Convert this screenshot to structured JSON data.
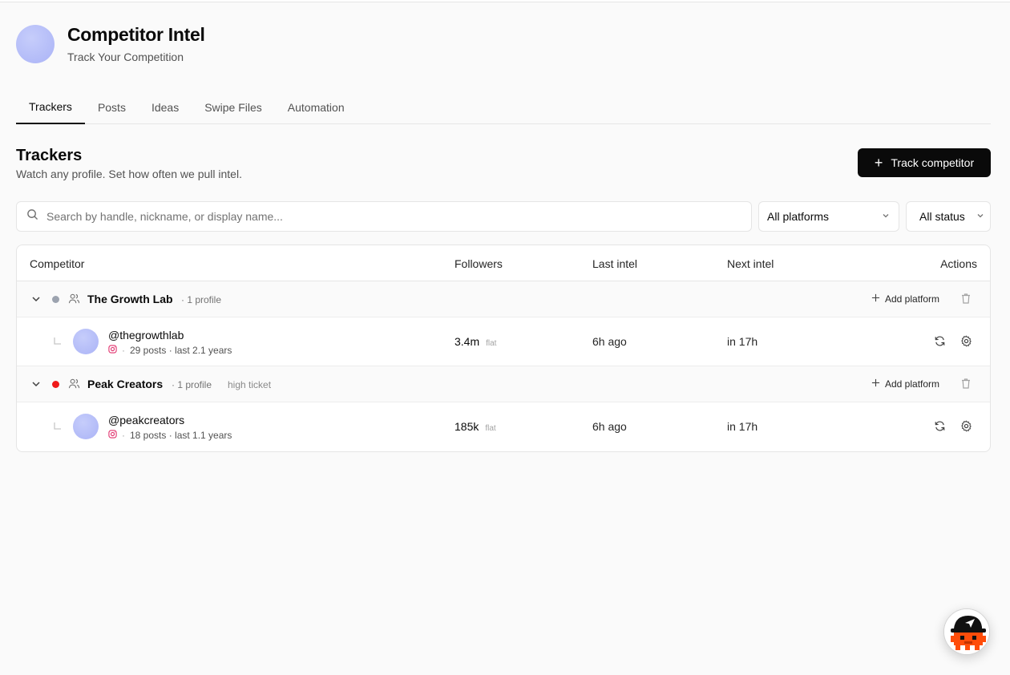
{
  "app": {
    "title": "Competitor Intel",
    "subtitle": "Track Your Competition"
  },
  "tabs": [
    {
      "label": "Trackers",
      "active": true
    },
    {
      "label": "Posts",
      "active": false
    },
    {
      "label": "Ideas",
      "active": false
    },
    {
      "label": "Swipe Files",
      "active": false
    },
    {
      "label": "Automation",
      "active": false
    }
  ],
  "section": {
    "title": "Trackers",
    "subtitle": "Watch any profile. Set how often we pull intel.",
    "primary_button": "Track competitor"
  },
  "filters": {
    "search_placeholder": "Search by handle, nickname, or display name...",
    "search_value": "",
    "platform": "All platforms",
    "status": "All status"
  },
  "table": {
    "columns": {
      "competitor": "Competitor",
      "followers": "Followers",
      "last_intel": "Last intel",
      "next_intel": "Next intel",
      "actions": "Actions"
    },
    "add_platform_label": "Add platform",
    "groups": [
      {
        "name": "The Growth Lab",
        "count": "· 1 profile",
        "tag": "",
        "status_color": "#9ca3af",
        "profile": {
          "handle": "@thegrowthlab",
          "platform_icon": "instagram-icon",
          "separator": "·",
          "meta": "29 posts · last 2.1 years",
          "followers": "3.4m",
          "trend": "flat",
          "last_intel": "6h ago",
          "next_intel": "in 17h"
        }
      },
      {
        "name": "Peak Creators",
        "count": "· 1 profile",
        "tag": "high ticket",
        "status_color": "#ef1a1a",
        "profile": {
          "handle": "@peakcreators",
          "platform_icon": "instagram-icon",
          "separator": "·",
          "meta": "18 posts · last 1.1 years",
          "followers": "185k",
          "trend": "flat",
          "last_intel": "6h ago",
          "next_intel": "in 17h"
        }
      }
    ]
  },
  "colors": {
    "primary": "#0a0a0a",
    "accent_avatar": "#b4bcf8",
    "instagram": "#e1306c",
    "widget_mascot": "#ff4d0a"
  }
}
